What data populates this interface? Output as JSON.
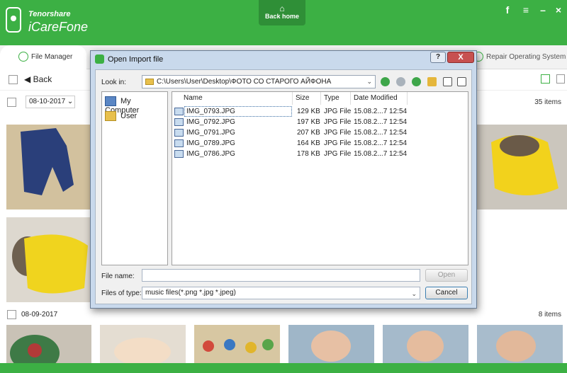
{
  "app": {
    "brand_small": "Tenorshare",
    "brand_name": "iCareFone",
    "back_home": "Back home",
    "accent": "#3cb044"
  },
  "tabs": {
    "active": "File Manager",
    "right": "Repair Operating System"
  },
  "toolbar": {
    "back": "Back"
  },
  "groups": [
    {
      "date": "08-10-2017",
      "count": "35 items"
    },
    {
      "date": "08-09-2017",
      "count": "8 items"
    }
  ],
  "dialog": {
    "title": "Open Import file",
    "help": "?",
    "close": "X",
    "look_in_label": "Look in:",
    "look_in_path": "C:\\Users\\User\\Desktop\\ФОТО СО СТАРОГО АЙФОНА",
    "places": [
      "My Computer",
      "User"
    ],
    "columns": {
      "name": "Name",
      "size": "Size",
      "type": "Type",
      "date": "Date Modified"
    },
    "files": [
      {
        "name": "IMG_0793.JPG",
        "size": "129 KB",
        "type": "JPG File",
        "date": "15.08.2...7 12:54"
      },
      {
        "name": "IMG_0792.JPG",
        "size": "197 KB",
        "type": "JPG File",
        "date": "15.08.2...7 12:54"
      },
      {
        "name": "IMG_0791.JPG",
        "size": "207 KB",
        "type": "JPG File",
        "date": "15.08.2...7 12:54"
      },
      {
        "name": "IMG_0789.JPG",
        "size": "164 KB",
        "type": "JPG File",
        "date": "15.08.2...7 12:54"
      },
      {
        "name": "IMG_0786.JPG",
        "size": "178 KB",
        "type": "JPG File",
        "date": "15.08.2...7 12:54"
      }
    ],
    "file_name_label": "File name:",
    "file_name_value": "",
    "files_of_type_label": "Files of type:",
    "files_of_type_value": "music files(*.png *.jpg *.jpeg)",
    "open_button": "Open",
    "cancel_button": "Cancel"
  }
}
